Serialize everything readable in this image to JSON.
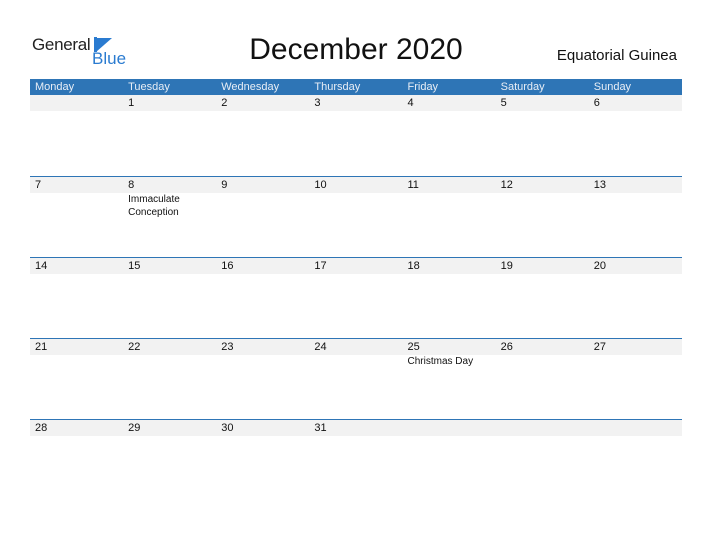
{
  "logo": {
    "line1": "General",
    "line2": "Blue"
  },
  "title": "December 2020",
  "country": "Equatorial Guinea",
  "colors": {
    "accent": "#2e75b6",
    "date_bar": "#f2f2f2"
  },
  "weekdays": [
    "Monday",
    "Tuesday",
    "Wednesday",
    "Thursday",
    "Friday",
    "Saturday",
    "Sunday"
  ],
  "weeks": [
    {
      "days": [
        "",
        "1",
        "2",
        "3",
        "4",
        "5",
        "6"
      ],
      "events": [
        "",
        "",
        "",
        "",
        "",
        "",
        ""
      ]
    },
    {
      "days": [
        "7",
        "8",
        "9",
        "10",
        "11",
        "12",
        "13"
      ],
      "events": [
        "",
        "Immaculate Conception",
        "",
        "",
        "",
        "",
        ""
      ]
    },
    {
      "days": [
        "14",
        "15",
        "16",
        "17",
        "18",
        "19",
        "20"
      ],
      "events": [
        "",
        "",
        "",
        "",
        "",
        "",
        ""
      ]
    },
    {
      "days": [
        "21",
        "22",
        "23",
        "24",
        "25",
        "26",
        "27"
      ],
      "events": [
        "",
        "",
        "",
        "",
        "Christmas Day",
        "",
        ""
      ]
    },
    {
      "days": [
        "28",
        "29",
        "30",
        "31",
        "",
        "",
        ""
      ],
      "events": [
        "",
        "",
        "",
        "",
        "",
        "",
        ""
      ]
    }
  ]
}
